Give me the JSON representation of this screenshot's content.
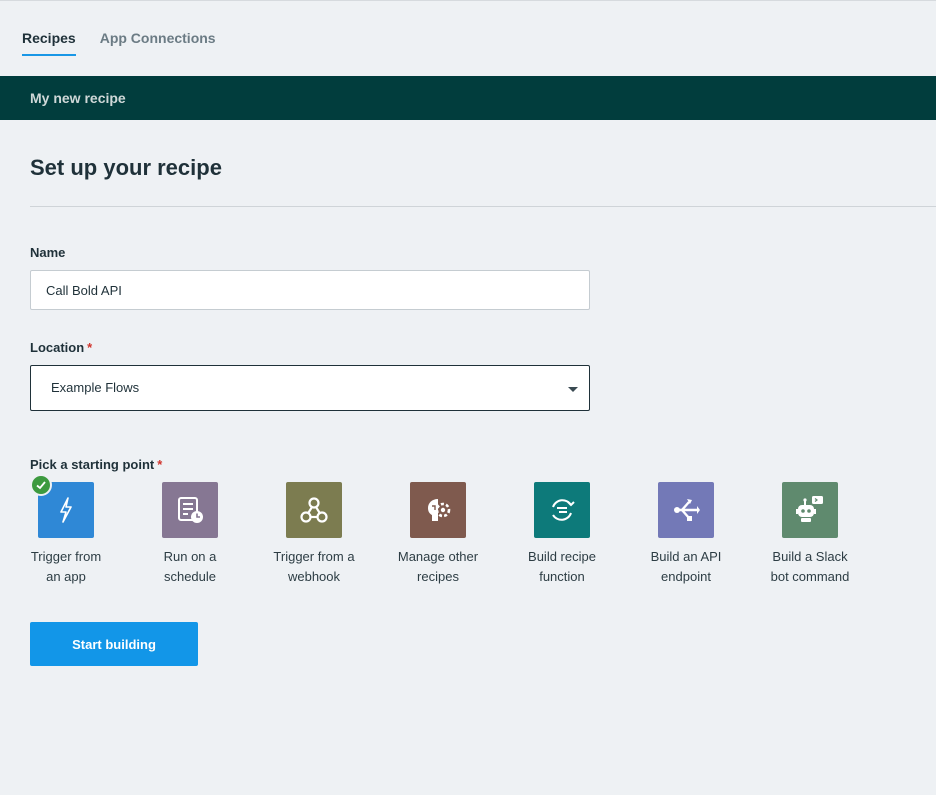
{
  "tabs": [
    {
      "label": "Recipes",
      "active": true
    },
    {
      "label": "App Connections",
      "active": false
    }
  ],
  "banner": {
    "title": "My new recipe"
  },
  "page": {
    "title": "Set up your recipe"
  },
  "form": {
    "name_label": "Name",
    "name_value": "Call Bold API",
    "location_label": "Location",
    "location_required": "*",
    "location_value": "Example Flows",
    "start_label": "Pick a starting point",
    "start_required": "*"
  },
  "starting_points": [
    {
      "line1": "Trigger from",
      "line2": "an app",
      "icon": "lightning-icon",
      "color": "#2f88d6",
      "selected": true
    },
    {
      "line1": "Run on a",
      "line2": "schedule",
      "icon": "schedule-icon",
      "color": "#867793",
      "selected": false
    },
    {
      "line1": "Trigger from a",
      "line2": "webhook",
      "icon": "webhook-icon",
      "color": "#7c7c50",
      "selected": false
    },
    {
      "line1": "Manage other",
      "line2": "recipes",
      "icon": "gear-brain-icon",
      "color": "#7f5a4e",
      "selected": false
    },
    {
      "line1": "Build recipe",
      "line2": "function",
      "icon": "function-icon",
      "color": "#0d7a7a",
      "selected": false
    },
    {
      "line1": "Build an API",
      "line2": "endpoint",
      "icon": "api-endpoint-icon",
      "color": "#7379b7",
      "selected": false
    },
    {
      "line1": "Build a Slack",
      "line2": "bot command",
      "icon": "slack-bot-icon",
      "color": "#5f8a6e",
      "selected": false
    }
  ],
  "actions": {
    "start_label": "Start building"
  },
  "colors": {
    "banner": "#013d3d",
    "primary": "#1296e8",
    "check": "#3d9a3f"
  }
}
